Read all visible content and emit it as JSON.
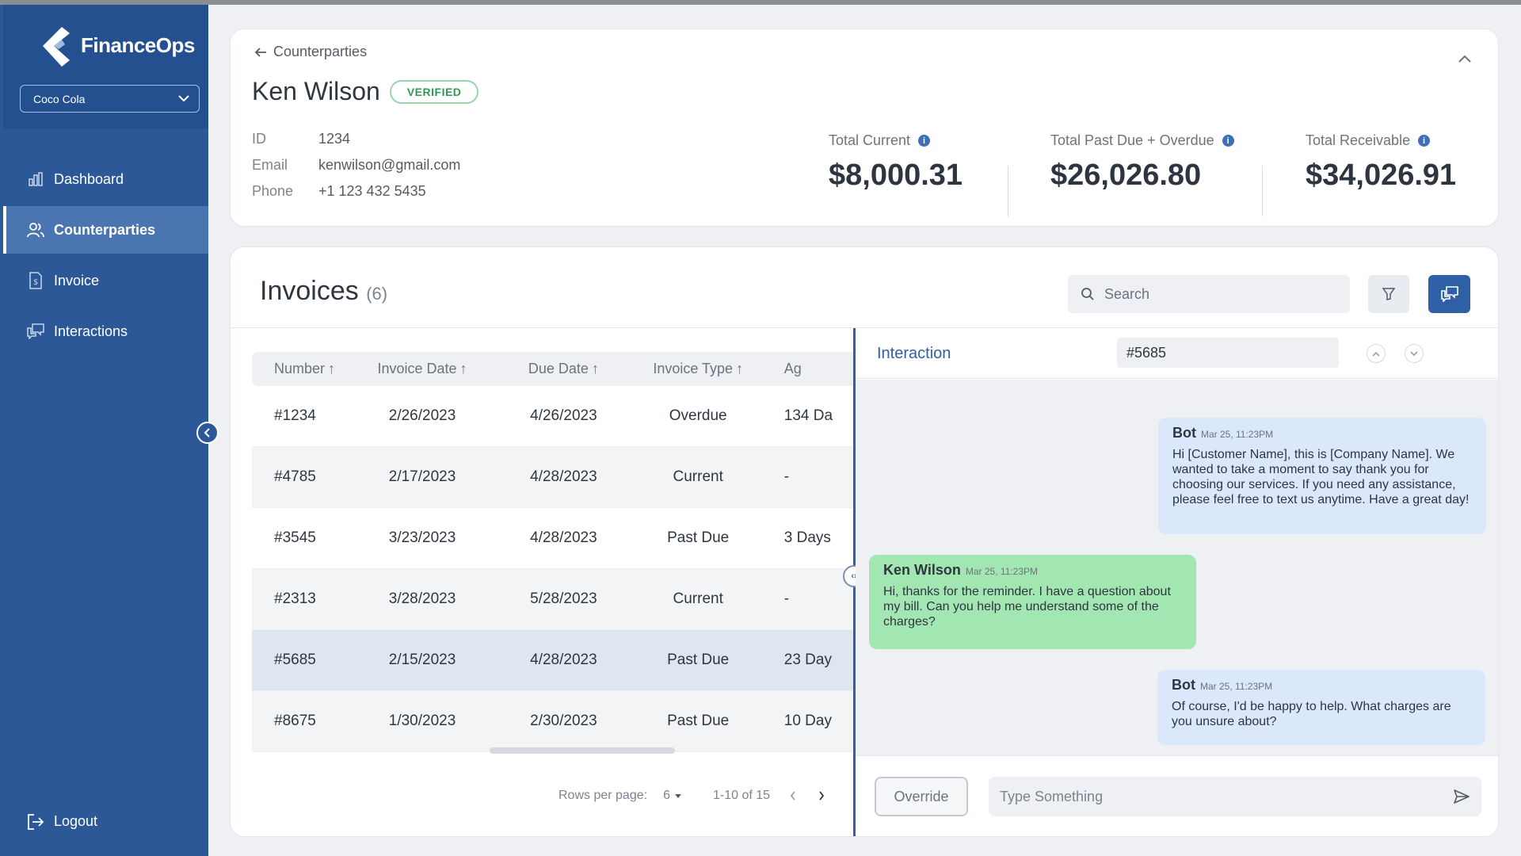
{
  "app": {
    "name": "FinanceOps",
    "org_selected": "Coco Cola"
  },
  "nav": {
    "items": [
      {
        "label": "Dashboard",
        "icon": "chart-icon",
        "active": false
      },
      {
        "label": "Counterparties",
        "icon": "users-icon",
        "active": true
      },
      {
        "label": "Invoice",
        "icon": "invoice-icon",
        "active": false
      },
      {
        "label": "Interactions",
        "icon": "chat-icon",
        "active": false
      }
    ],
    "logout": "Logout"
  },
  "profile": {
    "breadcrumb": "Counterparties",
    "name": "Ken Wilson",
    "badge": "VERIFIED",
    "fields": [
      {
        "label": "ID",
        "value": "1234"
      },
      {
        "label": "Email",
        "value": "kenwilson@gmail.com"
      },
      {
        "label": "Phone",
        "value": "+1 123 432 5435"
      }
    ],
    "totals": [
      {
        "label": "Total Current",
        "value": "$8,000.31"
      },
      {
        "label": "Total Past Due + Overdue",
        "value": "$26,026.80"
      },
      {
        "label": "Total Receivable",
        "value": "$34,026.91"
      }
    ]
  },
  "invoices": {
    "title": "Invoices",
    "count": "(6)",
    "search_placeholder": "Search",
    "columns": [
      "Number",
      "Invoice Date",
      "Due Date",
      "Invoice Type",
      "Ag"
    ],
    "rows": [
      [
        "#1234",
        "2/26/2023",
        "4/26/2023",
        "Overdue",
        "134 Da"
      ],
      [
        "#4785",
        "2/17/2023",
        "4/28/2023",
        "Current",
        "-"
      ],
      [
        "#3545",
        "3/23/2023",
        "4/28/2023",
        "Past Due",
        "3 Days"
      ],
      [
        "#2313",
        "3/28/2023",
        "5/28/2023",
        "Current",
        "-"
      ],
      [
        "#5685",
        "2/15/2023",
        "4/28/2023",
        "Past Due",
        "23 Day"
      ],
      [
        "#8675",
        "1/30/2023",
        "2/30/2023",
        "Past Due",
        "10 Day"
      ]
    ],
    "selected_row": 4,
    "pager": {
      "rows_per_page_label": "Rows per page:",
      "rows_per_page": "6",
      "range": "1-10 of 15"
    }
  },
  "interaction": {
    "title": "Interaction",
    "id": "#5685",
    "messages": [
      {
        "author": "Bot",
        "time": "Mar 25, 11:23PM",
        "text": "Hi [Customer Name], this is [Company Name]. We wanted to take a moment to say thank you for choosing our services. If you need any assistance, please feel free to text us anytime. Have a great day!"
      },
      {
        "author": "Ken Wilson",
        "time": "Mar 25, 11:23PM",
        "text": "Hi, thanks for the reminder. I have a question about my bill. Can you help me understand some of the charges?"
      },
      {
        "author": "Bot",
        "time": "Mar 25, 11:23PM",
        "text": "Of course, I'd be happy to help. What charges are you unsure about?"
      }
    ],
    "override_label": "Override",
    "input_placeholder": "Type Something"
  },
  "colors": {
    "sidebar": "#2c5898",
    "accent": "#2f5fa5",
    "verified": "#2f9a56",
    "bot_bubble": "#dbe8fb",
    "user_bubble": "#a2e6b2"
  }
}
